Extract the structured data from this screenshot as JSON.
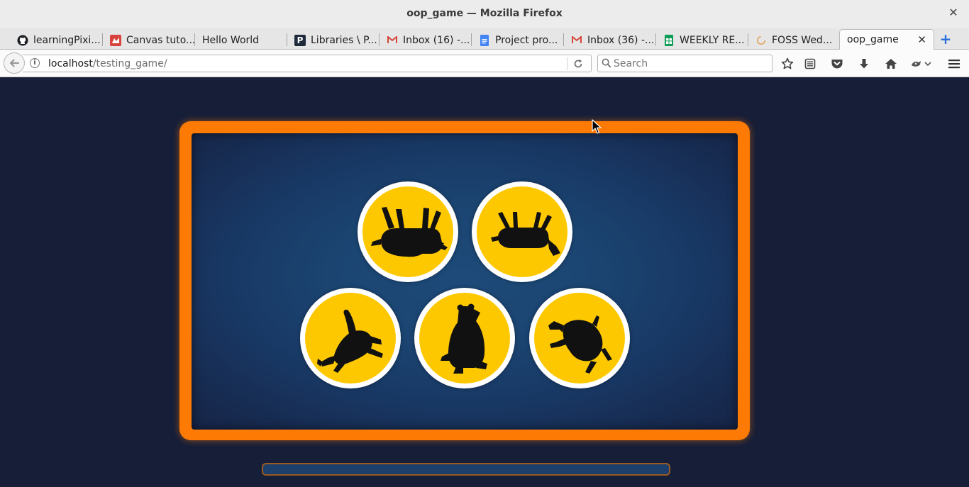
{
  "window": {
    "title": "oop_game — Mozilla Firefox"
  },
  "tabs": [
    {
      "label": "learningPixi...",
      "favicon": "github-icon"
    },
    {
      "label": "Canvas tuto...",
      "favicon": "mdn-icon"
    },
    {
      "label": "Hello World",
      "favicon": "none"
    },
    {
      "label": "Libraries \\ P...",
      "favicon": "p-icon"
    },
    {
      "label": "Inbox (16) -...",
      "favicon": "gmail-icon"
    },
    {
      "label": "Project pro...",
      "favicon": "docs-icon"
    },
    {
      "label": "Inbox (36) -...",
      "favicon": "gmail-icon"
    },
    {
      "label": "WEEKLY RE...",
      "favicon": "sheets-icon"
    },
    {
      "label": "FOSS Wed...",
      "favicon": "loading-icon"
    },
    {
      "label": "oop_game",
      "favicon": "none",
      "active": true
    }
  ],
  "navbar": {
    "url_host": "localhost",
    "url_path": "/testing_game/",
    "search_placeholder": "Search"
  },
  "game": {
    "tokens": [
      {
        "animal": "cow-icon",
        "orientation": "upside-down"
      },
      {
        "animal": "goat-icon",
        "orientation": "upside-down"
      },
      {
        "animal": "cat-icon",
        "orientation": "tilted"
      },
      {
        "animal": "bear-icon",
        "orientation": "upright"
      },
      {
        "animal": "dog-icon",
        "orientation": "tilted"
      }
    ],
    "progress": 0
  },
  "colors": {
    "background": "#161e38",
    "frame": "#fd7a05",
    "token_fill": "#fec800",
    "token_ring": "#ffffff",
    "board": "#1b4471"
  }
}
